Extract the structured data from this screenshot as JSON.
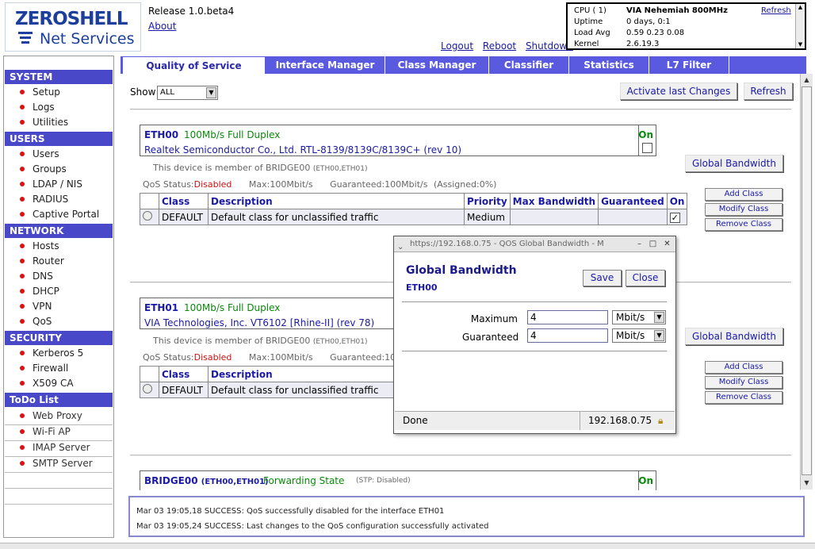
{
  "header": {
    "logo_top": "ZEROSHELL",
    "logo_bottom": "Net Services",
    "release": "Release 1.0.beta4",
    "about": "About",
    "logout": "Logout",
    "reboot": "Reboot",
    "shutdown": "Shutdown"
  },
  "sysinfo": {
    "cpu_label": "CPU ( 1)",
    "cpu_value": "VIA Nehemiah 800MHz",
    "refresh": "Refresh",
    "uptime_label": "Uptime",
    "uptime_value": "0 days, 0:1",
    "load_label": "Load Avg",
    "load_value": "0.59 0.23 0.08",
    "kernel_label": "Kernel",
    "kernel_value": "2.6.19.3"
  },
  "sidebar": {
    "system": {
      "title": "SYSTEM",
      "items": [
        "Setup",
        "Logs",
        "Utilities"
      ]
    },
    "users": {
      "title": "USERS",
      "items": [
        "Users",
        "Groups",
        "LDAP / NIS",
        "RADIUS",
        "Captive Portal"
      ]
    },
    "network": {
      "title": "NETWORK",
      "items": [
        "Hosts",
        "Router",
        "DNS",
        "DHCP",
        "VPN",
        "QoS"
      ]
    },
    "security": {
      "title": "SECURITY",
      "items": [
        "Kerberos 5",
        "Firewall",
        "X509 CA"
      ]
    },
    "todo": {
      "title": "ToDo List",
      "items": [
        "Web Proxy",
        "Wi-Fi AP",
        "IMAP Server",
        "SMTP Server"
      ]
    }
  },
  "tabs": [
    "Quality of Service",
    "Interface Manager",
    "Class Manager",
    "Classifier",
    "Statistics",
    "L7 Filter"
  ],
  "toolbar": {
    "show_label": "Show",
    "show_value": "ALL",
    "activate": "Activate last Changes",
    "refresh": "Refresh"
  },
  "eth00": {
    "name": "ETH00",
    "speed": "100Mb/s Full Duplex",
    "desc": "Realtek Semiconductor Co., Ltd. RTL-8139/8139C/8139C+ (rev 10)",
    "on": "On",
    "member": "This device is member of BRIDGE00",
    "member_small": "(ETH00,ETH01)",
    "qos_label": "QoS Status:",
    "qos_value": "Disabled",
    "max": "Max:100Mbit/s",
    "guaranteed": "Guaranteed:100Mbit/s",
    "assigned": "(Assigned:0%)",
    "global_bw": "Global Bandwidth",
    "cols": [
      "Class",
      "Description",
      "Priority",
      "Max Bandwidth",
      "Guaranteed",
      "On"
    ],
    "row": {
      "class": "DEFAULT",
      "desc": "Default class for unclassified traffic",
      "priority": "Medium",
      "check": "✓"
    }
  },
  "eth01": {
    "name": "ETH01",
    "speed": "100Mb/s Full Duplex",
    "desc": "VIA Technologies, Inc. VT6102 [Rhine-II] (rev 78)",
    "member": "This device is member of BRIDGE00",
    "member_small": "(ETH00,ETH01)",
    "qos_label": "QoS Status:",
    "qos_value": "Disabled",
    "max": "Max:100Mbit/s",
    "guaranteed": "Guaranteed:10",
    "global_bw": "Global Bandwidth",
    "cols": [
      "Class",
      "Description"
    ],
    "row": {
      "class": "DEFAULT",
      "desc": "Default class for unclassified traffic"
    }
  },
  "bridge": {
    "name": "BRIDGE00",
    "members": "(ETH00,ETH01)",
    "state": "Forwarding State",
    "stp": "(STP: Disabled)",
    "on": "On"
  },
  "class_buttons": {
    "add": "Add Class",
    "modify": "Modify Class",
    "remove": "Remove Class"
  },
  "log": [
    "Mar 03 19:05,18 SUCCESS: QoS successfully disabled for the interface ETH01",
    "Mar 03 19:05,24 SUCCESS: Last changes to the QoS configuration successfully activated"
  ],
  "popup": {
    "window_title": "https://192.168.0.75 - QOS Global Bandwidth - M",
    "title": "Global Bandwidth",
    "subtitle": "ETH00",
    "save": "Save",
    "close": "Close",
    "max_label": "Maximum",
    "max_value": "4",
    "max_unit": "Mbit/s",
    "g_label": "Guaranteed",
    "g_value": "4",
    "g_unit": "Mbit/s",
    "status_left": "Done",
    "status_right": "192.168.0.75"
  }
}
